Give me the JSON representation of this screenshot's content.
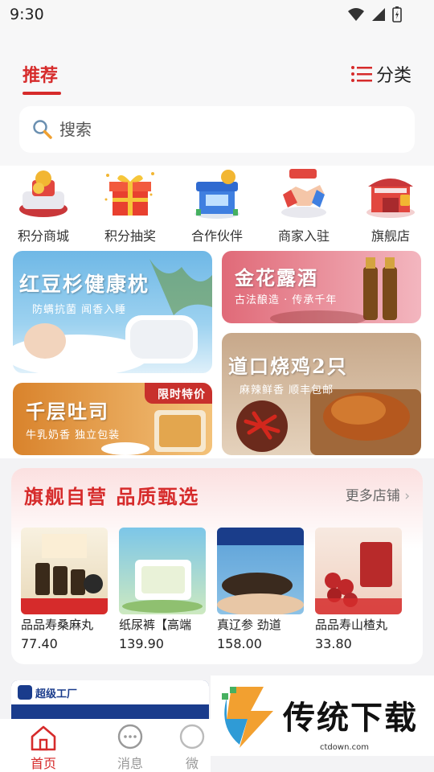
{
  "status": {
    "time": "9:30"
  },
  "header": {
    "tab_recommend": "推荐",
    "category_label": "分类"
  },
  "search": {
    "placeholder": "搜索"
  },
  "quick_icons": [
    {
      "label": "积分商城",
      "icon": "points-mall-icon"
    },
    {
      "label": "积分抽奖",
      "icon": "gift-box-icon"
    },
    {
      "label": "合作伙伴",
      "icon": "store-icon"
    },
    {
      "label": "商家入驻",
      "icon": "handshake-icon"
    },
    {
      "label": "旗舰店",
      "icon": "flagship-store-icon"
    }
  ],
  "banners": {
    "pillow": {
      "title": "红豆杉健康枕",
      "sub": "防螨抗菌   闻香入睡"
    },
    "wine": {
      "title": "金花露酒",
      "sub": "古法酿造 · 传承千年"
    },
    "toast": {
      "title": "千层吐司",
      "sub": "牛乳奶香  独立包装",
      "tag": "限时特价"
    },
    "chicken": {
      "title": "道口烧鸡2只",
      "sub": "麻辣鲜香   顺丰包邮"
    }
  },
  "flagship": {
    "title": "旗舰自营  品质甄选",
    "more": "更多店铺",
    "products": [
      {
        "name": "品品寿桑麻丸",
        "price": "77.40"
      },
      {
        "name": "纸尿裤【高端",
        "price": "139.90"
      },
      {
        "name": "真辽参 劲道",
        "price": "158.00"
      },
      {
        "name": "品品寿山楂丸",
        "price": "33.80"
      }
    ]
  },
  "bottom_banner": {
    "text": "超级工厂"
  },
  "watermark": {
    "text": "传统下载",
    "url": "ctdown.com"
  },
  "tabbar": [
    {
      "label": "首页",
      "active": true
    },
    {
      "label": "消息",
      "active": false
    },
    {
      "label": "微",
      "active": false
    }
  ],
  "colors": {
    "accent": "#d62b2b"
  }
}
